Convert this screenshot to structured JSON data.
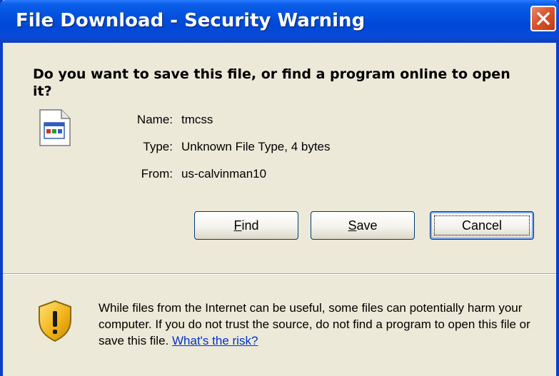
{
  "window": {
    "title": "File Download - Security Warning",
    "colors": {
      "titlebar": "#0452e0",
      "dialog_bg": "#ece9d8",
      "close_button": "#d9542b",
      "link": "#0033cc"
    }
  },
  "dialog": {
    "question": "Do you want to save this file, or find a program online to open it?",
    "file_icon": "generic-file-icon",
    "details": [
      {
        "label": "Name:",
        "value": "tmcss"
      },
      {
        "label": "Type:",
        "value": "Unknown File Type, 4 bytes"
      },
      {
        "label": "From:",
        "value": "us-calvinman10"
      }
    ]
  },
  "buttons": {
    "find": {
      "accel": "F",
      "rest": "ind"
    },
    "save": {
      "accel": "S",
      "rest": "ave"
    },
    "cancel": "Cancel"
  },
  "warning": {
    "icon": "security-shield-icon",
    "text": "While files from the Internet can be useful, some files can potentially harm your computer. If you do not trust the source, do not find a program to open this file or save this file. ",
    "link": "What's the risk?"
  }
}
